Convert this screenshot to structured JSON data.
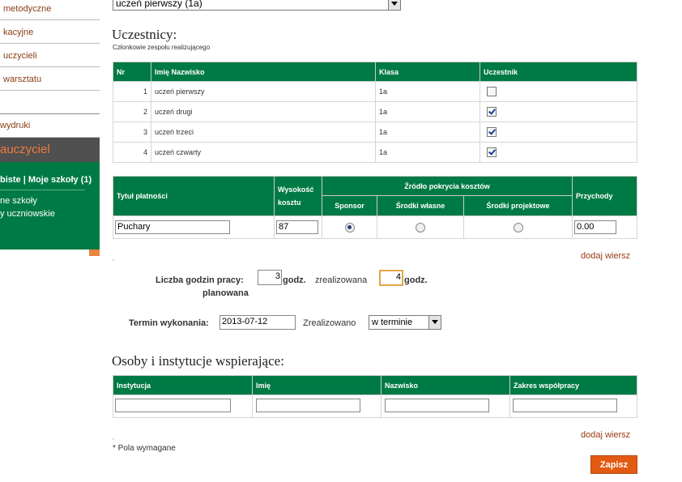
{
  "sidebar": {
    "items": [
      "metodyczne",
      "kacyjne",
      "uczycieli",
      "warsztatu"
    ],
    "wydruki": "wydruki",
    "section_title": "auczyciel",
    "links": {
      "profile": "biste",
      "separator": " | ",
      "schools": "Moje szkoły (1)"
    },
    "sub_items": [
      "ne szkoły",
      "y uczniowskie"
    ]
  },
  "top_select": {
    "value": "uczeń pierwszy (1a)"
  },
  "participants": {
    "title": "Uczestnicy:",
    "subtitle": "Członkowie zespołu realizującego",
    "columns": [
      "Nr",
      "Imię Nazwisko",
      "Klasa",
      "Uczestnik"
    ],
    "rows": [
      {
        "nr": "1",
        "name": "uczeń pierwszy",
        "klasa": "1a",
        "checked": false
      },
      {
        "nr": "2",
        "name": "uczeń drugi",
        "klasa": "1a",
        "checked": true
      },
      {
        "nr": "3",
        "name": "uczeń trzeci",
        "klasa": "1a",
        "checked": true
      },
      {
        "nr": "4",
        "name": "uczeń czwarty",
        "klasa": "1a",
        "checked": true
      }
    ]
  },
  "costs": {
    "col_title": "Tytuł płatności",
    "col_amount": "Wysokość kosztu",
    "col_source": "Źródło pokrycia kosztów",
    "col_sponsor": "Sponsor",
    "col_own": "Środki własne",
    "col_project": "Środki projektowe",
    "col_income": "Przychody",
    "row": {
      "title": "Puchary",
      "amount": "87",
      "source_selected": "sponsor",
      "income": "0.00"
    },
    "dot": ",",
    "add_row": "dodaj wiersz"
  },
  "hours": {
    "label_line1": "Liczba godzin pracy:",
    "label_line2": "planowana",
    "planned": "3",
    "unit": "godz.",
    "realized_label": "zrealizowana",
    "realized": "4"
  },
  "deadline": {
    "label": "Termin wykonania:",
    "value": "2013-07-12",
    "status_label": "Zrealizowano",
    "status_value": "w terminie"
  },
  "support": {
    "title": "Osoby i instytucje wspierające:",
    "columns": [
      "Instytucja",
      "Imię",
      "Nazwisko",
      "Zakres współpracy"
    ],
    "dot": ",",
    "add_row": "dodaj wiersz"
  },
  "required_note": "* Pola wymagane",
  "save_button": "Zapisz"
}
